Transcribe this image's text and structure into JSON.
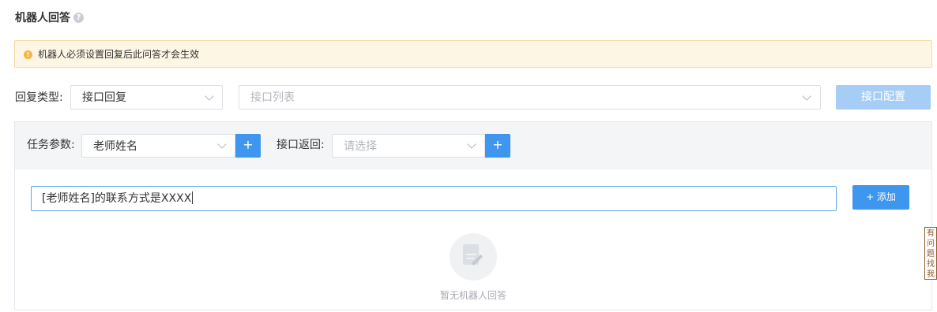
{
  "header": {
    "title": "机器人回答",
    "help_icon": "question-circle-icon"
  },
  "alert": {
    "icon": "info-circle-icon",
    "text": "机器人必须设置回复后此问答才会生效",
    "colors": {
      "background": "#fdf6e4",
      "border": "#f7d9a2",
      "icon": "#f5b83d"
    }
  },
  "reply_type": {
    "label": "回复类型:",
    "selected": "接口回复",
    "api_list_placeholder": "接口列表",
    "config_button": "接口配置"
  },
  "task_panel": {
    "task_param_label": "任务参数:",
    "task_param_selected": "老师姓名",
    "task_param_add": "+",
    "api_return_label": "接口返回:",
    "api_return_placeholder": "请选择",
    "api_return_add": "+",
    "answer_value": "[老师姓名]的联系方式是XXXX",
    "add_button": "+ 添加",
    "empty_text": "暂无机器人回答"
  },
  "feedback_tab": {
    "text": "有问题找我"
  },
  "theme": {
    "primary": "#3e96ee",
    "primary_disabled": "#a5cdf5",
    "panel_bg": "#f4f5f7"
  }
}
